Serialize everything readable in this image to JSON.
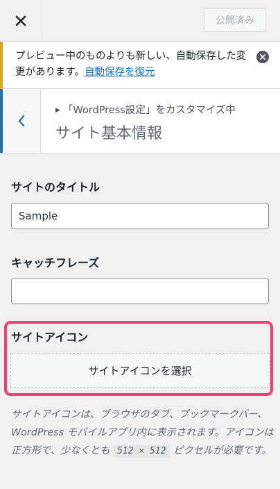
{
  "topbar": {
    "close_label": "Close",
    "publish_label": "公開済み"
  },
  "notice": {
    "text": "プレビュー中のものよりも新しい、自動保存した変更があります。",
    "link": "自動保存を復元"
  },
  "header": {
    "breadcrumb": "「WordPress設定」をカスタマイズ中",
    "title": "サイト基本情報"
  },
  "fields": {
    "site_title_label": "サイトのタイトル",
    "site_title_value": "Sample",
    "tagline_label": "キャッチフレーズ",
    "tagline_value": "",
    "site_icon_label": "サイトアイコン",
    "select_icon_button": "サイトアイコンを選択"
  },
  "description": {
    "text": "サイトアイコンは、ブラウザのタブ、ブックマークバー、WordPress モバイルアプリ内に表示されます。アイコンは正方形で、少なくとも",
    "size": "512 × 512",
    "suffix": "ピクセルが必要です。"
  },
  "colors": {
    "notice_accent": "#dba617",
    "header_accent": "#2271b1",
    "highlight": "#f53c7a"
  }
}
